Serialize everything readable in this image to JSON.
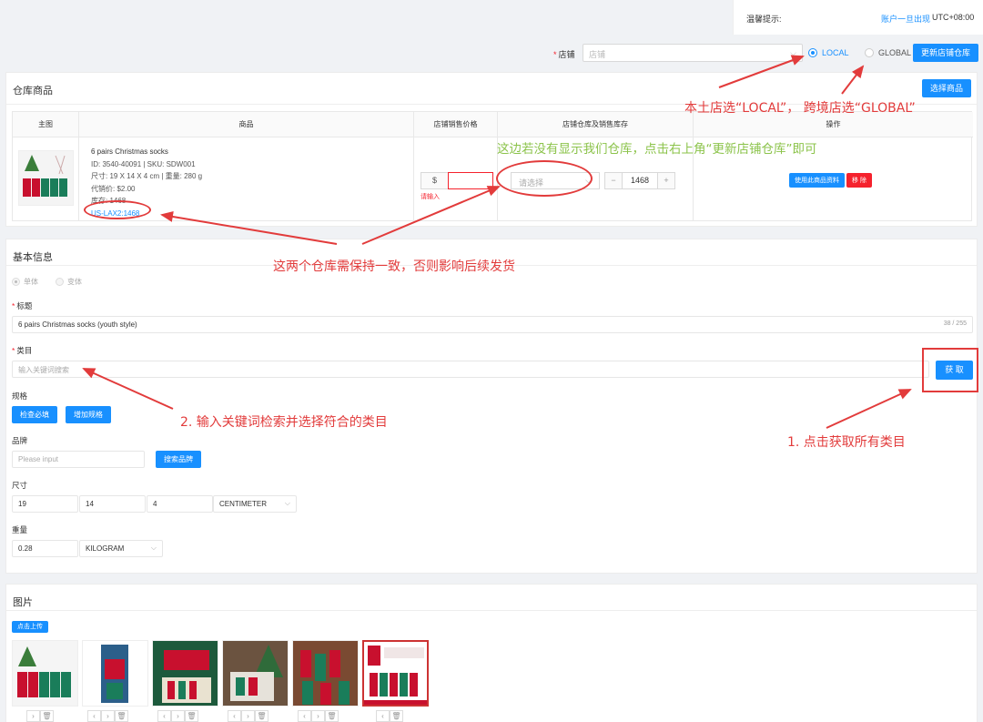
{
  "topbar": {
    "tip": "温馨提示:",
    "link": "账户一旦出现",
    "timezone": "UTC+08:00"
  },
  "storebar": {
    "label": "店铺",
    "select_placeholder": "店铺",
    "radio_local": "LOCAL",
    "radio_global": "GLOBAL",
    "selected": "LOCAL",
    "update_button": "更新店铺仓库"
  },
  "goods": {
    "title": "仓库商品",
    "select_button": "选择商品",
    "columns": [
      "主图",
      "商品",
      "店铺销售价格",
      "店铺仓库及销售库存",
      "操作"
    ],
    "product": {
      "name": "6 pairs Christmas socks",
      "id_sku": "ID: 3540-40091 | SKU: SDW001",
      "size_weight": "尺寸: 19 X 14 X 4 cm | 重量: 280 g",
      "cost": "代销价: $2.00",
      "stock": "库存: 1468",
      "warehouse": "US-LAX2:1468"
    },
    "currency": "$",
    "price_error": "请输入",
    "warehouse_placeholder": "请选择",
    "stock_value": "1468",
    "use_info_button": "使用此商品资料",
    "remove_button": "移 除"
  },
  "basic": {
    "title": "基本信息",
    "radio_single": "单体",
    "radio_variant": "变体",
    "title_label": "标题",
    "title_value": "6 pairs Christmas socks  (youth style)",
    "title_counter": "38 / 255",
    "category_label": "类目",
    "category_placeholder": "输入关键词搜索",
    "get_button": "获 取",
    "spec_label": "规格",
    "check_required_button": "检查必填",
    "add_spec_button": "增加规格",
    "brand_label": "品牌",
    "brand_placeholder": "Please input",
    "search_brand_button": "搜索品牌",
    "size_label": "尺寸",
    "size_values": [
      "19",
      "14",
      "4"
    ],
    "size_unit": "CENTIMETER",
    "weight_label": "重量",
    "weight_value": "0.28",
    "weight_unit": "KILOGRAM"
  },
  "images": {
    "title": "图片",
    "upload_button": "点击上传"
  },
  "annotations": {
    "store_hint": "本土店选“LOCAL”，  跨境店选“GLOBAL”",
    "warehouse_hint": "这边若没有显示我们仓库，点击右上角“更新店铺仓库”即可",
    "consistency_hint": "这两个仓库需保持一致，否则影响后续发货",
    "category_hint": "2. 输入关键词检索并选择符合的类目",
    "get_hint": "1. 点击获取所有类目"
  },
  "colors": {
    "primary": "#1890ff",
    "danger": "#f5222d",
    "annotation": "#e23b3b",
    "annotation_green": "#8bc34a"
  }
}
